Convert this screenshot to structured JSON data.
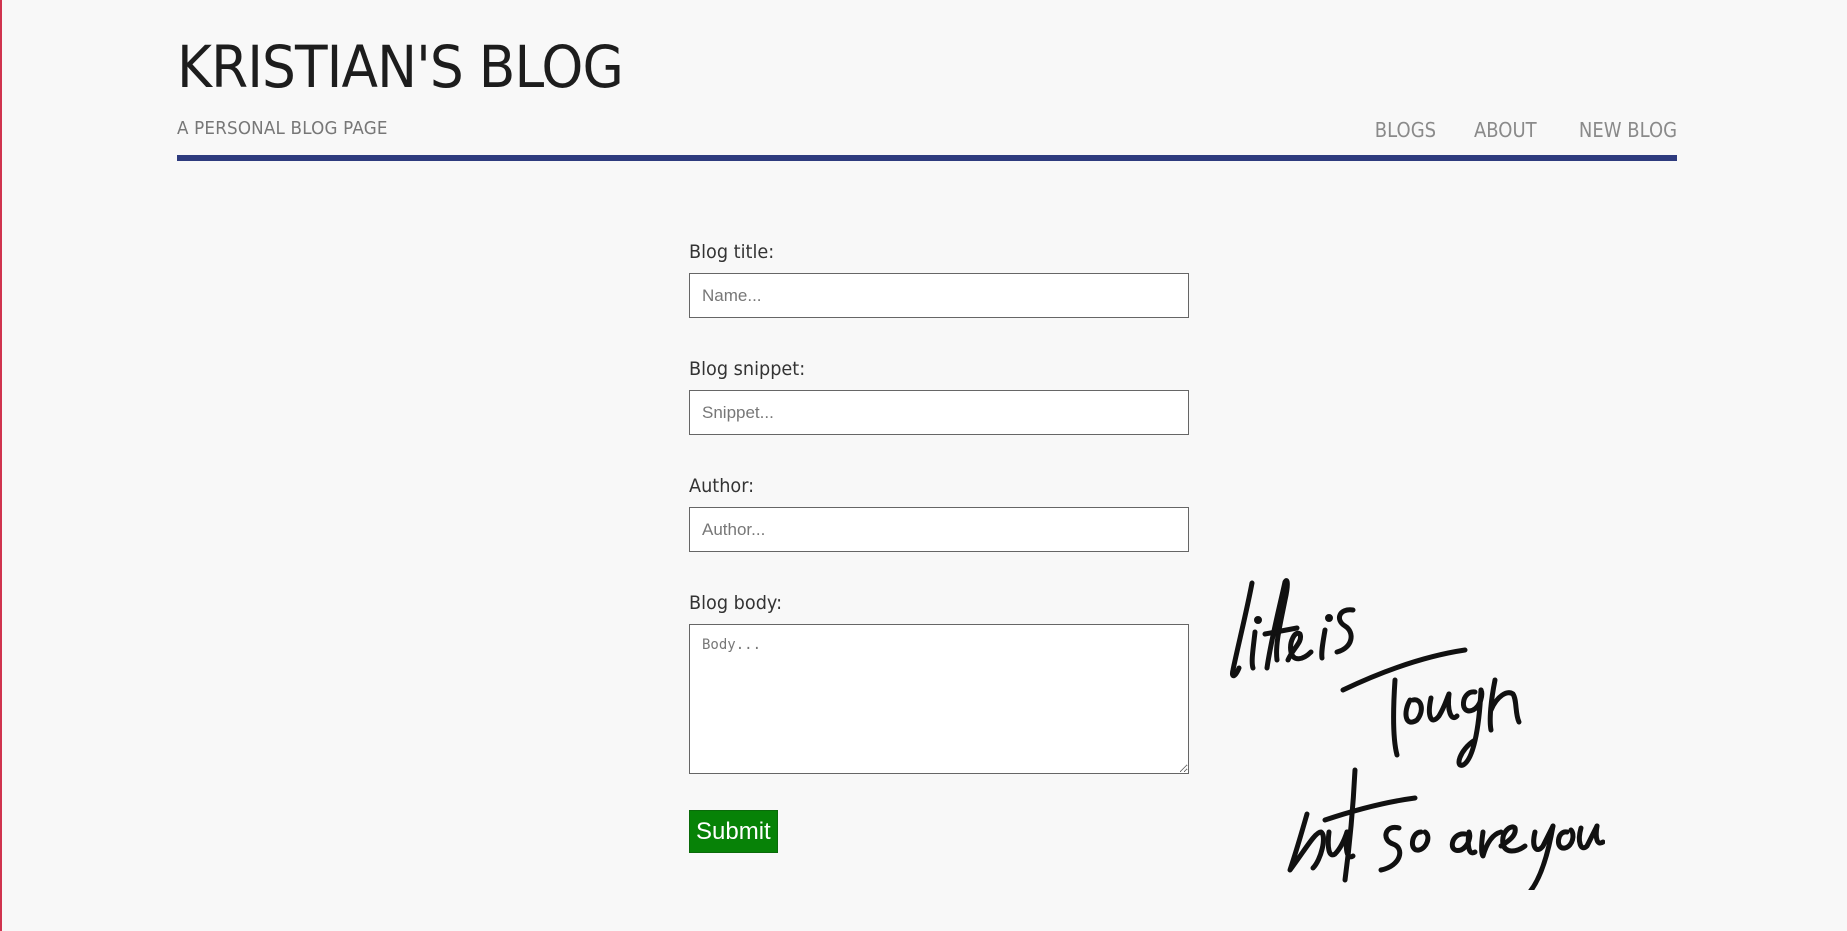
{
  "header": {
    "title": "KRISTIAN'S BLOG",
    "subtitle": "A PERSONAL BLOG PAGE"
  },
  "nav": {
    "items": [
      {
        "label": "BLOGS"
      },
      {
        "label": "ABOUT"
      },
      {
        "label": "NEW BLOG"
      }
    ]
  },
  "form": {
    "title_label": "Blog title:",
    "title_placeholder": "Name...",
    "title_value": "",
    "snippet_label": "Blog snippet:",
    "snippet_placeholder": "Snippet...",
    "snippet_value": "",
    "author_label": "Author:",
    "author_placeholder": "Author...",
    "author_value": "",
    "body_label": "Blog body:",
    "body_placeholder": "Body...",
    "body_value": "",
    "submit_label": "Submit"
  },
  "decoration": {
    "quote_text": "life is tough but so are you"
  },
  "colors": {
    "accent_rule": "#2e3b7e",
    "submit_bg": "#078207",
    "page_bg": "#f8f8f8",
    "nav_text": "#8a8a8a"
  }
}
